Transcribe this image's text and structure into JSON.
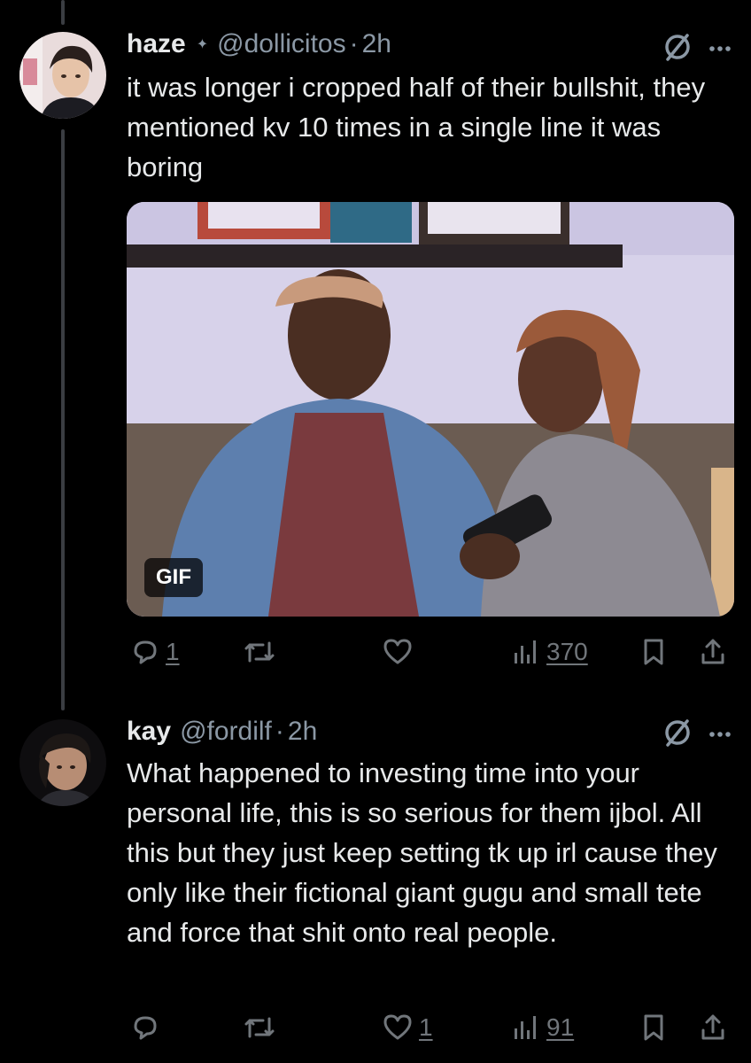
{
  "tweets": [
    {
      "name": "haze",
      "verified_glyph": "✦",
      "handle": "@dollicitos",
      "time": "2h",
      "text": "it was longer i cropped half of their bullshit, they mentioned kv 10 times in a single line it was boring",
      "media": {
        "badge": "GIF",
        "type": "animated-gif"
      },
      "actions": {
        "replies": "1",
        "retweets": "",
        "likes": "",
        "views": "370"
      }
    },
    {
      "name": "kay",
      "handle": "@fordilf",
      "time": "2h",
      "text": "What happened to investing time into your personal life, this is so serious for them ijbol. All this but they just keep setting tk up irl cause they only like their fictional giant gugu and small tete and force that shit onto real people.",
      "actions": {
        "replies": "",
        "retweets": "",
        "likes": "1",
        "views": "91"
      }
    }
  ],
  "ui": {
    "separator": "·",
    "icons": [
      "reply-icon",
      "retweet-icon",
      "like-icon",
      "views-icon",
      "bookmark-icon",
      "share-icon",
      "hide-icon",
      "more-icon"
    ]
  },
  "colors": {
    "background": "#000000",
    "text": "#e7e9ea",
    "muted": "#71767b",
    "thread_line": "#3a3d42"
  }
}
